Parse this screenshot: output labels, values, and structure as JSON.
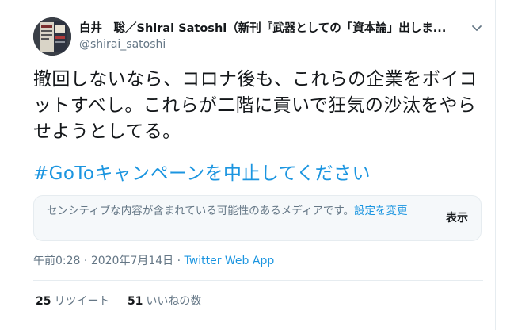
{
  "author": {
    "display_name": "白井　聡／Shirai Satoshi（新刊『武器としての「資本論」出しま...",
    "handle": "@shirai_satoshi"
  },
  "tweet": {
    "text": "撤回しないなら、コロナ後も、これらの企業をボイコットすべし。これらが二階に貢いで狂気の沙汰をやらせようとしてる。",
    "hashtag": "#GoToキャンペーンを中止してください"
  },
  "sensitive_notice": {
    "text": "センシティブな内容が含まれている可能性のあるメディアです。",
    "settings_link": "設定を変更",
    "show_button": "表示"
  },
  "meta": {
    "time": "午前0:28",
    "separator1": " · ",
    "date": "2020年7月14日",
    "separator2": " · ",
    "source": "Twitter Web App"
  },
  "stats": {
    "retweets_count": "25",
    "retweets_label": "リツイート",
    "likes_count": "51",
    "likes_label": "いいねの数"
  },
  "icons": {
    "more": "chevron-down-icon",
    "avatar": "book-cover-avatar"
  },
  "colors": {
    "link": "#1b95e0",
    "text": "#14171a",
    "secondary": "#657786",
    "border": "#e6ecf0",
    "panel": "#f5f8fa"
  }
}
